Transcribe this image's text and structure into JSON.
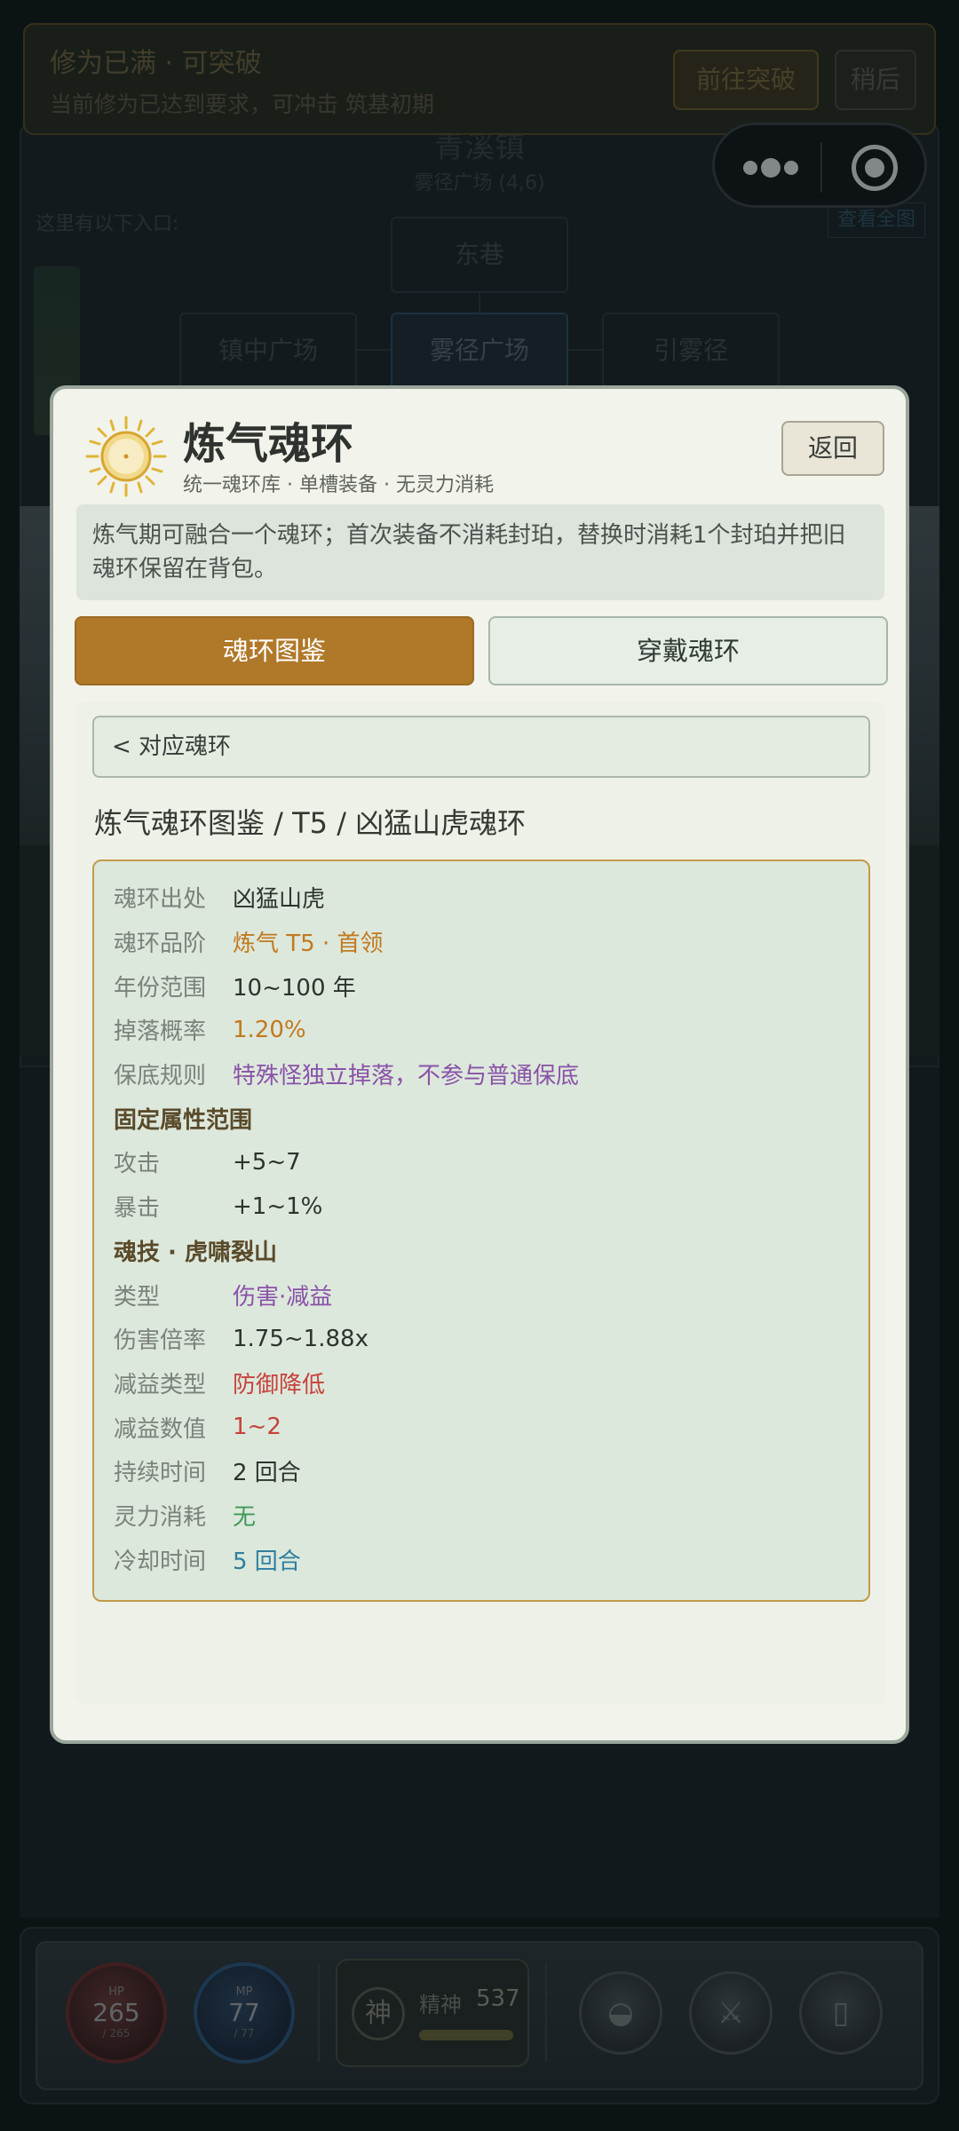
{
  "background": {
    "town_title": "青溪镇",
    "location": "雾径广场 (4,6)",
    "entrances_label": "这里有以下入口:",
    "view_all": "查看全图",
    "nodes": {
      "north": "东巷",
      "left": "镇中广场",
      "center": "雾径广场",
      "right": "引雾径"
    }
  },
  "notice": {
    "title": "修为已满 · 可突破",
    "desc": "当前修为已达到要求，可冲击 筑基初期",
    "go_button": "前往突破",
    "later_button": "稍后"
  },
  "modal": {
    "title": "炼气魂环",
    "subtitle": "统一魂环库 · 单槽装备 · 无灵力消耗",
    "back_button": "返回",
    "description": "炼气期可融合一个魂环；首次装备不消耗封珀，替换时消耗1个封珀并把旧魂环保留在背包。",
    "tabs": [
      "魂环图鉴",
      "穿戴魂环"
    ],
    "breadcrumb_button": "<  对应魂环",
    "path": "炼气魂环图鉴 / T5 / 凶猛山虎魂环",
    "details": {
      "source": {
        "label": "魂环出处",
        "value": "凶猛山虎"
      },
      "grade": {
        "label": "魂环品阶",
        "value": "炼气 T5 · 首领"
      },
      "years": {
        "label": "年份范围",
        "value": "10~100 年"
      },
      "drop": {
        "label": "掉落概率",
        "value": "1.20%"
      },
      "pity": {
        "label": "保底规则",
        "value": "特殊怪独立掉落，不参与普通保底"
      },
      "fixed_attr_title": "固定属性范围",
      "attack": {
        "label": "攻击",
        "value": "+5~7"
      },
      "crit": {
        "label": "暴击",
        "value": "+1~1%"
      },
      "skill_title": "魂技 · 虎啸裂山",
      "type": {
        "label": "类型",
        "value": "伤害·减益"
      },
      "dmg_mult": {
        "label": "伤害倍率",
        "value": "1.75~1.88x"
      },
      "debuff_type": {
        "label": "减益类型",
        "value": "防御降低"
      },
      "debuff_value": {
        "label": "减益数值",
        "value": "1~2"
      },
      "duration": {
        "label": "持续时间",
        "value": "2 回合"
      },
      "mana_cost": {
        "label": "灵力消耗",
        "value": "无"
      },
      "cooldown": {
        "label": "冷却时间",
        "value": "5 回合"
      }
    }
  },
  "hud": {
    "hp": {
      "tag": "HP",
      "value": "265",
      "max": "/ 265"
    },
    "mp": {
      "tag": "MP",
      "value": "77",
      "max": "/ 77"
    },
    "spirit": {
      "badge": "神",
      "label": "精神",
      "value": "537",
      "fill_fraction": 1.0
    },
    "buttons": [
      "bag-icon",
      "battle-icon",
      "phone-icon"
    ]
  },
  "colors": {
    "accent_gold": "#b07829",
    "detail_border": "#c19a4a",
    "orange": "#c2791e",
    "purple": "#8a52a8",
    "red": "#c8423c",
    "green": "#3f9a5a",
    "blue": "#2f7ea0"
  }
}
